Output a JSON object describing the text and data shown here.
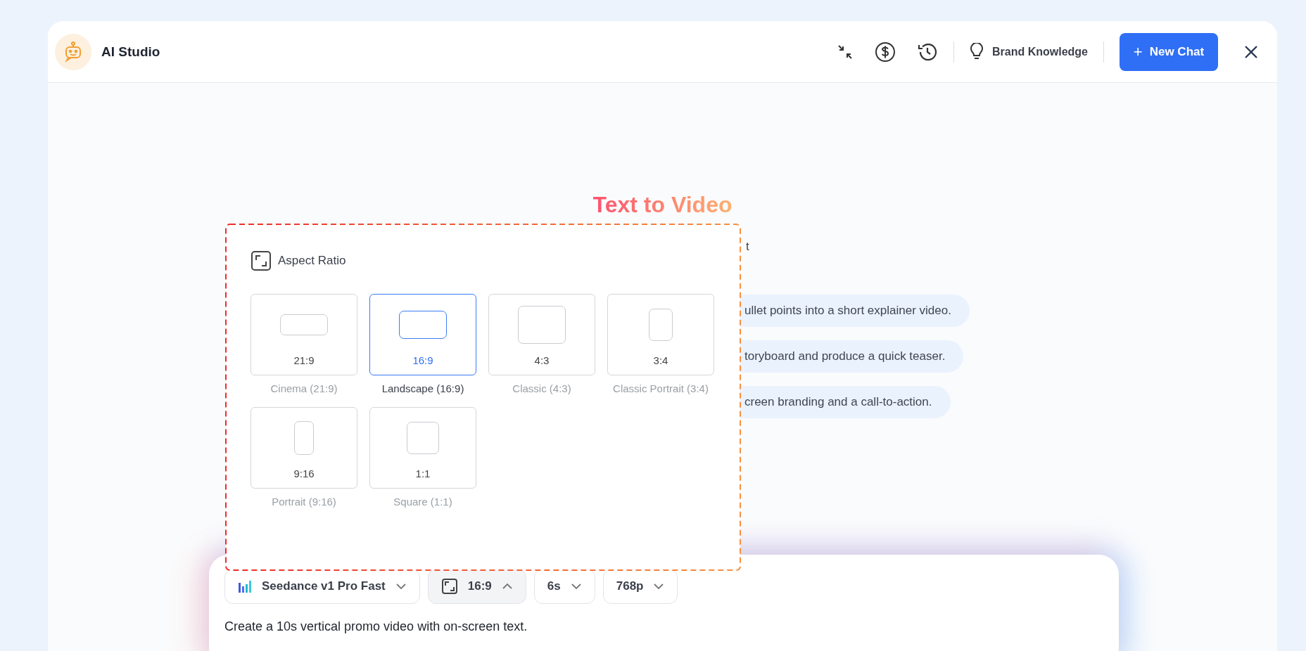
{
  "header": {
    "title": "AI Studio",
    "brand_knowledge": "Brand Knowledge",
    "new_chat": {
      "icon": "+",
      "label": "New Chat"
    }
  },
  "hero": {
    "title": "Text to Video",
    "subtitle_fragment": "t"
  },
  "suggestions": [
    "ullet points into a short explainer video.",
    "toryboard and produce a quick teaser.",
    "creen branding and a call-to-action."
  ],
  "aspect_popup": {
    "title": "Aspect Ratio",
    "options": [
      {
        "kind": "cinema",
        "ratio": "21:9",
        "label": "Cinema (21:9)",
        "selected": false
      },
      {
        "kind": "landscape",
        "ratio": "16:9",
        "label": "Landscape (16:9)",
        "selected": true
      },
      {
        "kind": "classic",
        "ratio": "4:3",
        "label": "Classic (4:3)",
        "selected": false
      },
      {
        "kind": "classic_portrait",
        "ratio": "3:4",
        "label": "Classic Portrait (3:4)",
        "selected": false
      },
      {
        "kind": "portrait",
        "ratio": "9:16",
        "label": "Portrait (9:16)",
        "selected": false
      },
      {
        "kind": "square",
        "ratio": "1:1",
        "label": "Square (1:1)",
        "selected": false
      }
    ]
  },
  "composer": {
    "model": "Seedance v1 Pro Fast",
    "ratio": {
      "label": "16:9",
      "expanded": true
    },
    "duration": "6s",
    "resolution": "768p",
    "prompt": "Create a 10s vertical promo video with on-screen text."
  }
}
